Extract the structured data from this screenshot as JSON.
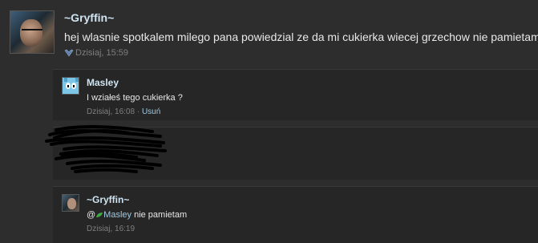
{
  "post": {
    "author": "~Gryffin~",
    "message": "hej wlasnie spotkalem milego pana powiedzial ze da mi cukierka wiecej grzechow nie pamietam",
    "timestamp": "Dzisiaj, 15:59",
    "like_icon": "heart-icon"
  },
  "replies": [
    {
      "author": "Masley",
      "message": "I wziałeś tego cukierka ?",
      "timestamp": "Dzisiaj, 16:08",
      "separator": "·",
      "delete_label": "Usuń",
      "avatar_icon": "gumball-avatar"
    },
    {
      "author": "",
      "message": "",
      "timestamp": "",
      "redacted": true
    },
    {
      "author": "~Gryffin~",
      "mention_prefix": "@",
      "mention_name": "Masley",
      "message": " nie pamietam",
      "timestamp": "Dzisiaj, 16:19",
      "avatar_icon": "person-avatar"
    }
  ],
  "colors": {
    "background": "#2d2d2d",
    "reply_background": "#262626",
    "author": "#cfe4f2",
    "text": "#e8e8e8",
    "meta": "#7f7f7f",
    "link": "#9fc9e4"
  }
}
